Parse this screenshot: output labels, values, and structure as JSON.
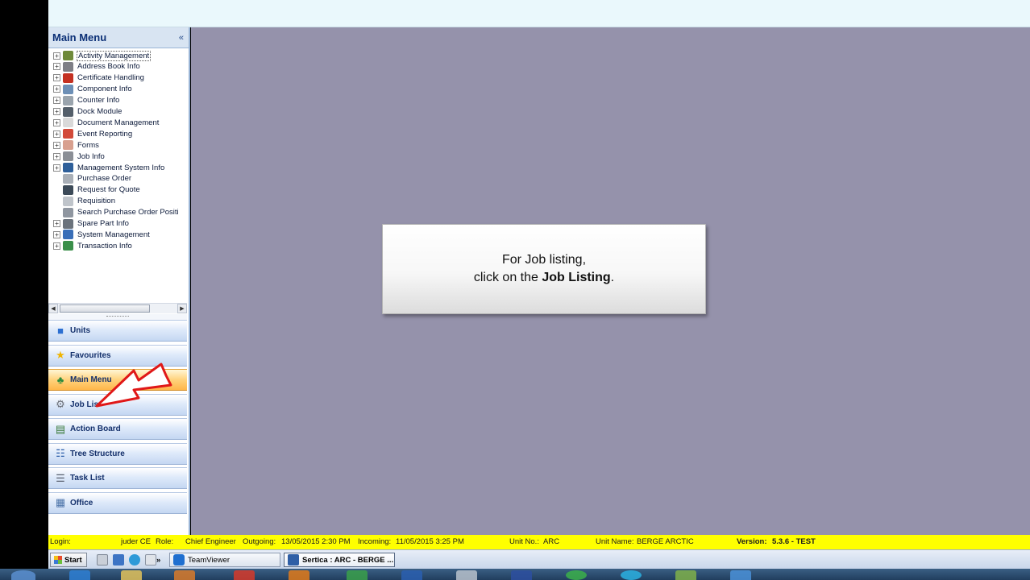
{
  "app": {
    "sidebar_title": "Main Menu",
    "collapse_glyph": "«"
  },
  "tree": {
    "items": [
      {
        "label": "Activity Management",
        "icon": "activity-icon",
        "color": "#6f8a3a",
        "expandable": true,
        "selected": true
      },
      {
        "label": "Address Book Info",
        "icon": "address-book-icon",
        "color": "#7e7f86",
        "expandable": true
      },
      {
        "label": "Certificate Handling",
        "icon": "certificate-icon",
        "color": "#c43122",
        "expandable": true
      },
      {
        "label": "Component Info",
        "icon": "component-icon",
        "color": "#6c8fb6",
        "expandable": true
      },
      {
        "label": "Counter Info",
        "icon": "counter-icon",
        "color": "#9aa4ad",
        "expandable": true
      },
      {
        "label": "Dock Module",
        "icon": "anchor-icon",
        "color": "#545f6a",
        "expandable": true
      },
      {
        "label": "Document Management",
        "icon": "document-icon",
        "color": "#d9d9d9",
        "expandable": true
      },
      {
        "label": "Event Reporting",
        "icon": "event-report-icon",
        "color": "#d24a3a",
        "expandable": true
      },
      {
        "label": "Forms",
        "icon": "forms-icon",
        "color": "#d8a08f",
        "expandable": true
      },
      {
        "label": "Job Info",
        "icon": "job-tools-icon",
        "color": "#8b8f96",
        "expandable": true
      },
      {
        "label": "Management System Info",
        "icon": "management-book-icon",
        "color": "#2e5f9a",
        "expandable": true
      },
      {
        "label": "Purchase Order",
        "icon": "purchase-order-icon",
        "color": "#a9afb7",
        "expandable": false
      },
      {
        "label": "Request for Quote",
        "icon": "quote-request-icon",
        "color": "#3c4a58",
        "expandable": false
      },
      {
        "label": "Requisition",
        "icon": "requisition-icon",
        "color": "#bfc4ca",
        "expandable": false
      },
      {
        "label": "Search Purchase Order Positi",
        "icon": "search-order-icon",
        "color": "#8f96a0",
        "expandable": false
      },
      {
        "label": "Spare Part Info",
        "icon": "spare-part-icon",
        "color": "#6b737d",
        "expandable": true
      },
      {
        "label": "System Management",
        "icon": "system-management-icon",
        "color": "#3a6fb8",
        "expandable": true
      },
      {
        "label": "Transaction Info",
        "icon": "transaction-globe-icon",
        "color": "#3a8f4a",
        "expandable": true
      }
    ]
  },
  "nav_buttons": [
    {
      "label": "Units",
      "icon": "units-cube-icon",
      "glyph": "■",
      "color": "#2c6fd1",
      "active": false
    },
    {
      "label": "Favourites",
      "icon": "star-icon",
      "glyph": "★",
      "color": "#f0b400",
      "active": false
    },
    {
      "label": "Main Menu",
      "icon": "palm-tree-icon",
      "glyph": "♣",
      "color": "#2e8b3d",
      "active": true
    },
    {
      "label": "Job Lis",
      "icon": "job-list-tools-icon",
      "glyph": "⚙",
      "color": "#6a6f78",
      "active": false
    },
    {
      "label": "Action Board",
      "icon": "action-board-icon",
      "glyph": "▤",
      "color": "#3a7a3a",
      "active": false
    },
    {
      "label": "Tree Structure",
      "icon": "tree-structure-icon",
      "glyph": "☷",
      "color": "#2a5da8",
      "active": false
    },
    {
      "label": "Task List",
      "icon": "task-list-icon",
      "glyph": "☰",
      "color": "#5a6270",
      "active": false
    },
    {
      "label": "Office",
      "icon": "office-icon",
      "glyph": "▦",
      "color": "#4a72a8",
      "active": false
    }
  ],
  "callout": {
    "line1": "For Job listing,",
    "line2_prefix": "click on the ",
    "line2_bold": "Job Listing",
    "line2_suffix": "."
  },
  "status_bar": {
    "login_label": "Login:",
    "login_value": "juder CE",
    "role_label": "Role:",
    "role_value": "Chief Engineer",
    "outgoing_label": "Outgoing:",
    "outgoing_value": "13/05/2015 2:30 PM",
    "incoming_label": "Incoming:",
    "incoming_value": "11/05/2015 3:25 PM",
    "unit_no_label": "Unit No.:",
    "unit_no_value": "ARC",
    "unit_name_label": "Unit Name:",
    "unit_name_value": "BERGE ARCTIC",
    "version_label": "Version:",
    "version_value": "5.3.6 - TEST"
  },
  "taskbar": {
    "start_label": "Start",
    "overflow_glyph": "»",
    "teamviewer_label": "TeamViewer",
    "sertica_label": "Sertica : ARC - BERGE ..."
  },
  "colors": {
    "workspace": "#9592ab",
    "status_bar": "#ffff00",
    "accent_active": "#ffb74a",
    "annotation_arrow": "#e01818"
  }
}
